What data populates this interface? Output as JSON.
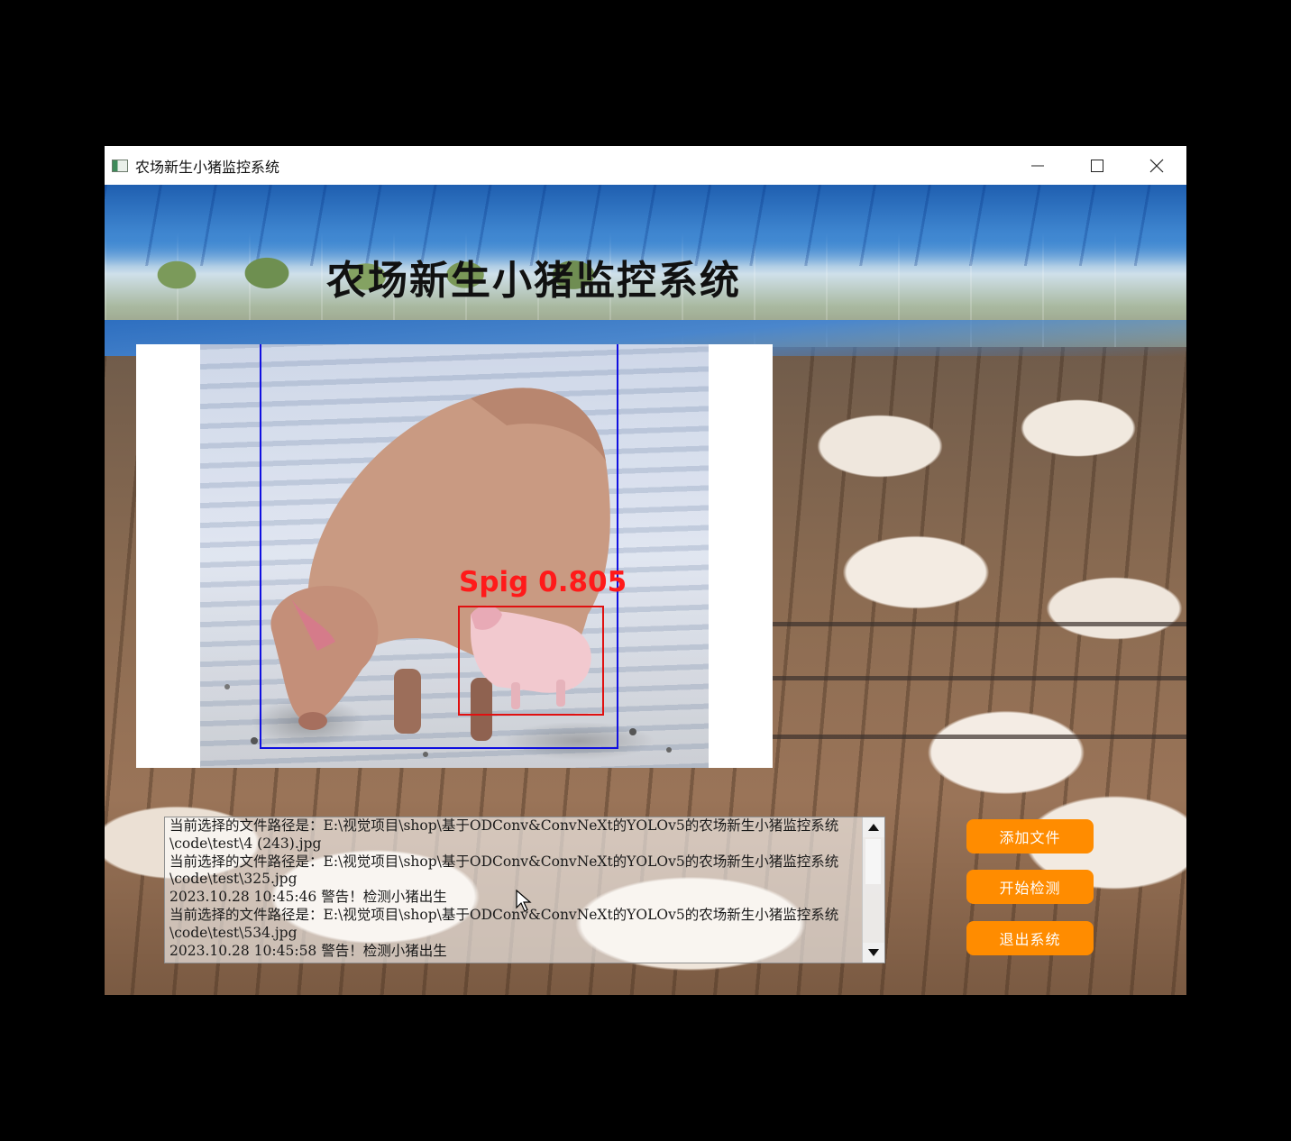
{
  "window": {
    "title": "农场新生小猪监控系统"
  },
  "header": {
    "title": "农场新生小猪监控系统"
  },
  "detection": {
    "label": "Spig 0.805",
    "box_colors": {
      "large": "#1010e0",
      "small": "#e01010"
    }
  },
  "log": {
    "lines": [
      "当前选择的文件路径是：E:\\视觉项目\\shop\\基于ODConv&ConvNeXt的YOLOv5的农场新生小猪监控系统",
      "\\code\\test\\4 (243).jpg",
      "当前选择的文件路径是：E:\\视觉项目\\shop\\基于ODConv&ConvNeXt的YOLOv5的农场新生小猪监控系统",
      "\\code\\test\\325.jpg",
      "2023.10.28 10:45:46 警告！检测小猪出生",
      "当前选择的文件路径是：E:\\视觉项目\\shop\\基于ODConv&ConvNeXt的YOLOv5的农场新生小猪监控系统",
      "\\code\\test\\534.jpg",
      "2023.10.28 10:45:58 警告！检测小猪出生"
    ]
  },
  "buttons": {
    "add_file": "添加文件",
    "start_detect": "开始检测",
    "exit": "退出系统"
  },
  "colors": {
    "button_bg": "#ff8c00",
    "button_text": "#ffffff"
  }
}
